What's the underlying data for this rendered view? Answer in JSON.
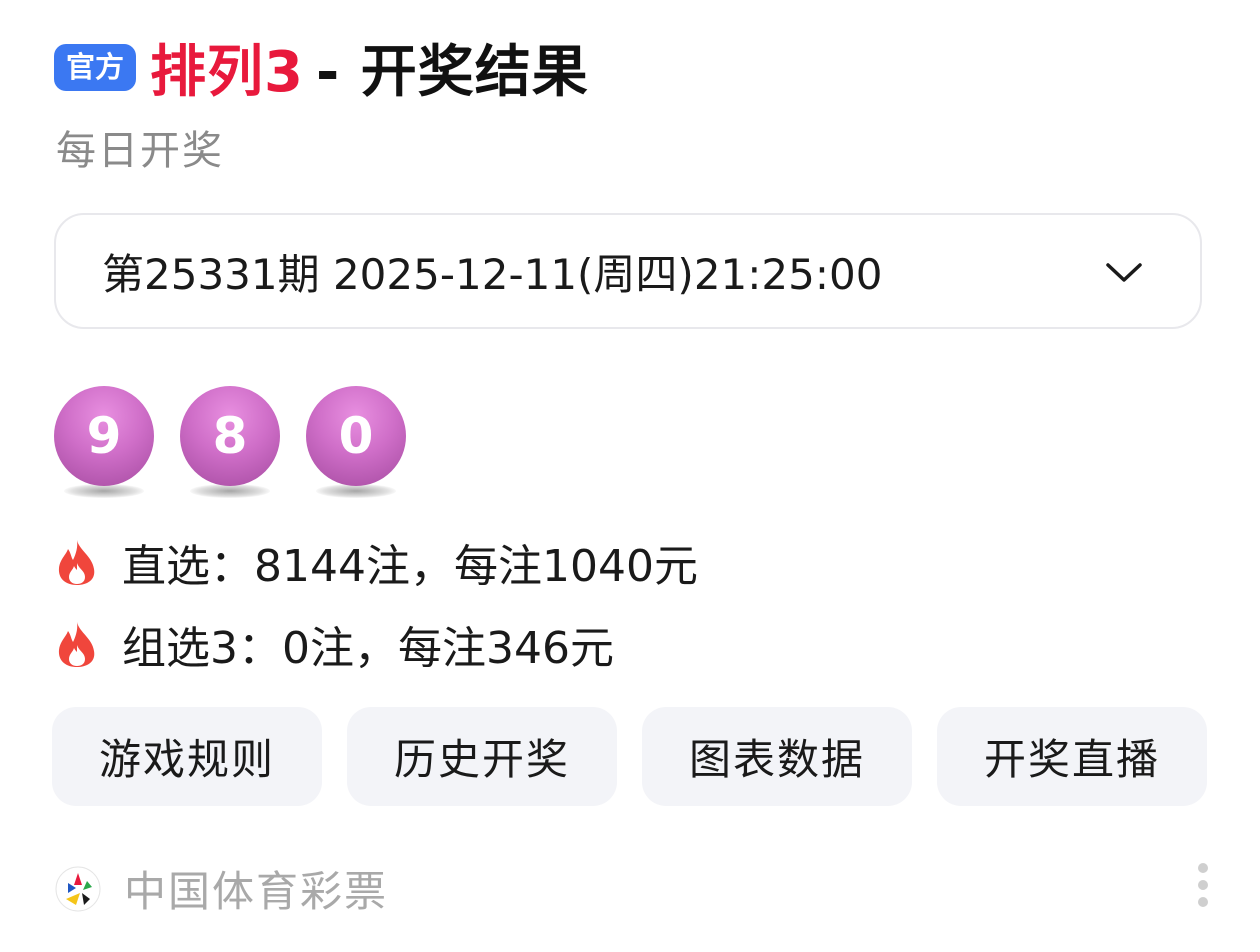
{
  "header": {
    "badge": "官方",
    "title_highlight": "排列3",
    "title_rest": "- 开奖结果",
    "subtitle": "每日开奖"
  },
  "selector": {
    "label": "第25331期 2025-12-11(周四)21:25:00",
    "icon": "chevron-down-icon"
  },
  "balls": [
    "9",
    "8",
    "0"
  ],
  "prizes": [
    {
      "icon": "fire-icon",
      "text": "直选：8144注，每注1040元"
    },
    {
      "icon": "fire-icon",
      "text": "组选3：0注，每注346元"
    }
  ],
  "actions": [
    "游戏规则",
    "历史开奖",
    "图表数据",
    "开奖直播"
  ],
  "footer": {
    "source": "中国体育彩票",
    "logo": "china-sports-lottery-logo",
    "more_icon": "more-vertical-icon"
  },
  "colors": {
    "badge": "#3b78f2",
    "title_red": "#e8193c",
    "ball": "#cf6ec8",
    "fire": "#f0463c",
    "button_bg": "#f3f4f8"
  }
}
